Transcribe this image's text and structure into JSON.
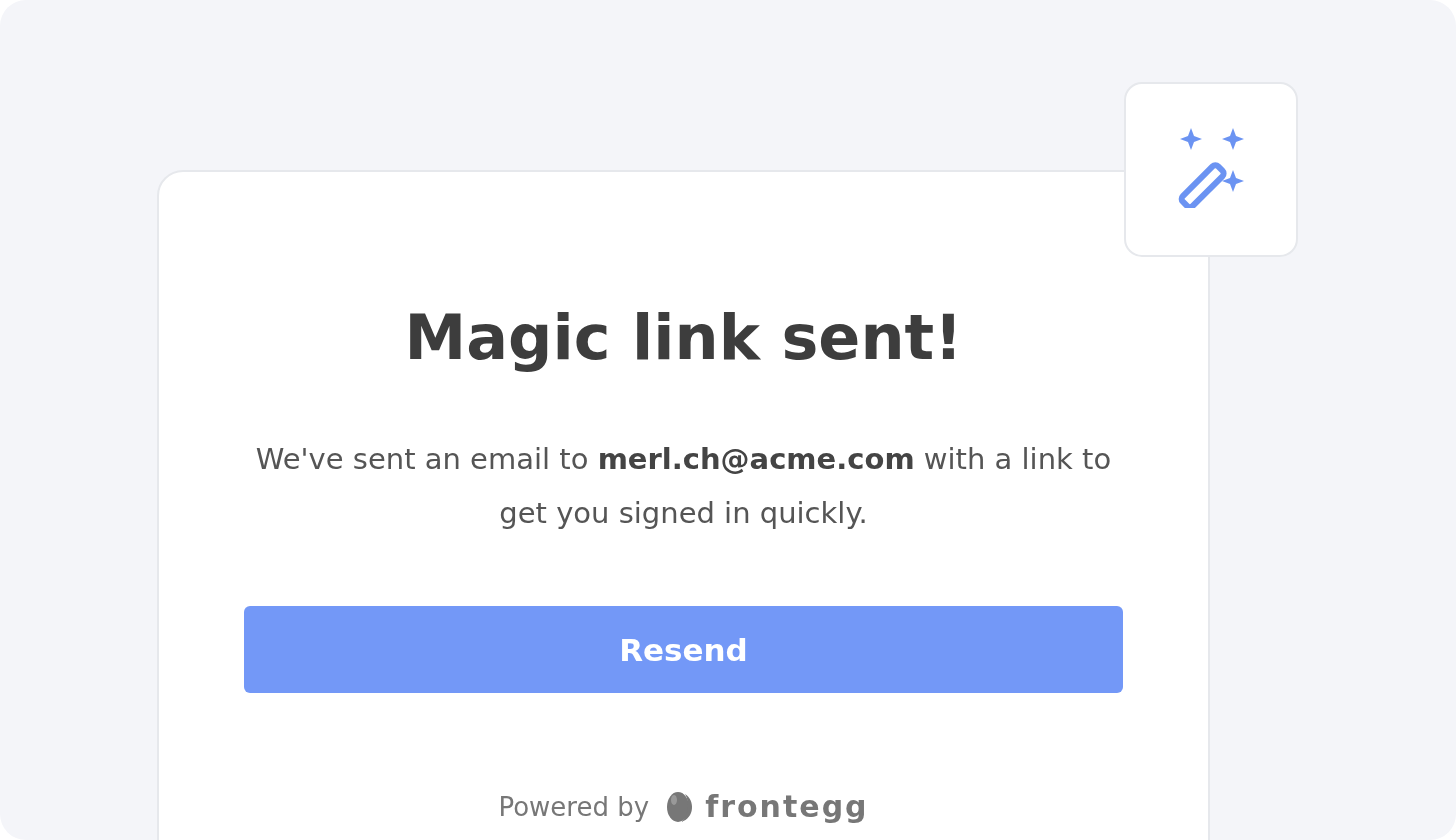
{
  "card": {
    "title": "Magic link sent!",
    "message": "We've sent an email to **merl.ch@acme.com** with a link to get you signed in quickly.",
    "button": "Resend",
    "footer": {
      "powered_by": "Powered by",
      "brand": "frontegg"
    }
  }
}
